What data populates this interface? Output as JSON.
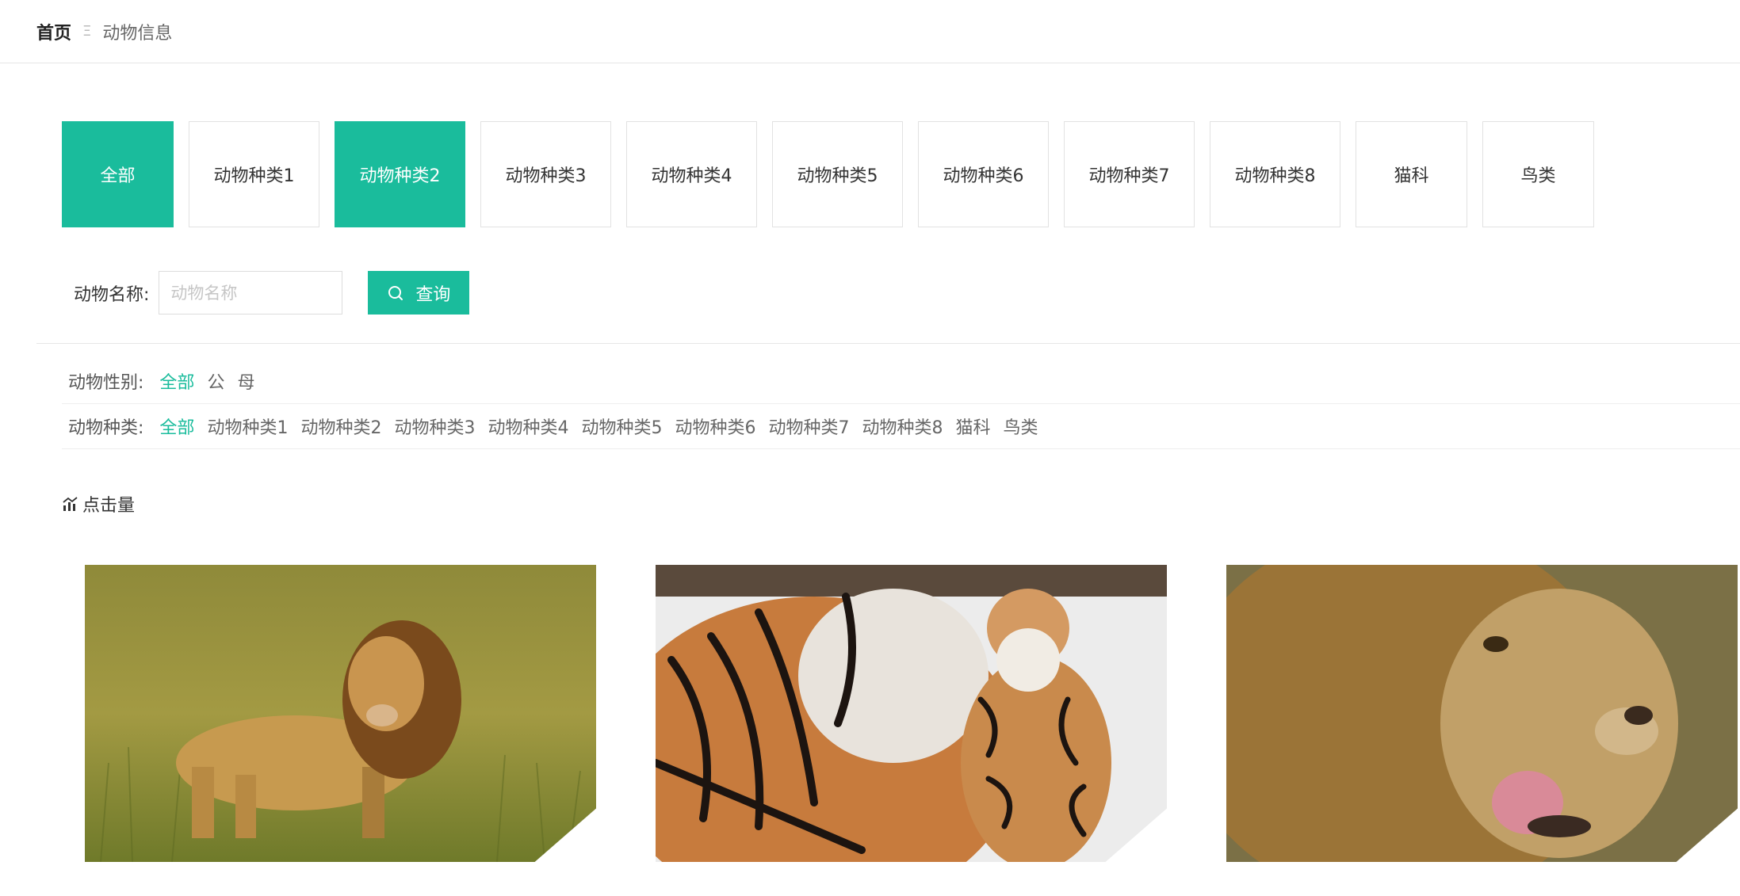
{
  "breadcrumb": {
    "home": "首页",
    "separator": "Ξ",
    "current": "动物信息"
  },
  "type_tabs": [
    {
      "label": "全部",
      "active": true
    },
    {
      "label": "动物种类1",
      "active": false
    },
    {
      "label": "动物种类2",
      "active": true
    },
    {
      "label": "动物种类3",
      "active": false
    },
    {
      "label": "动物种类4",
      "active": false
    },
    {
      "label": "动物种类5",
      "active": false
    },
    {
      "label": "动物种类6",
      "active": false
    },
    {
      "label": "动物种类7",
      "active": false
    },
    {
      "label": "动物种类8",
      "active": false
    },
    {
      "label": "猫科",
      "active": false
    },
    {
      "label": "鸟类",
      "active": false
    }
  ],
  "search": {
    "label": "动物名称:",
    "placeholder": "动物名称",
    "value": "",
    "button": "查询",
    "button_icon": "search-icon"
  },
  "filters": {
    "gender": {
      "label": "动物性别:",
      "options": [
        {
          "label": "全部",
          "active": true
        },
        {
          "label": "公",
          "active": false
        },
        {
          "label": "母",
          "active": false
        }
      ]
    },
    "kind": {
      "label": "动物种类:",
      "options": [
        {
          "label": "全部",
          "active": true
        },
        {
          "label": "动物种类1",
          "active": false
        },
        {
          "label": "动物种类2",
          "active": false
        },
        {
          "label": "动物种类3",
          "active": false
        },
        {
          "label": "动物种类4",
          "active": false
        },
        {
          "label": "动物种类5",
          "active": false
        },
        {
          "label": "动物种类6",
          "active": false
        },
        {
          "label": "动物种类7",
          "active": false
        },
        {
          "label": "动物种类8",
          "active": false
        },
        {
          "label": "猫科",
          "active": false
        },
        {
          "label": "鸟类",
          "active": false
        }
      ]
    }
  },
  "sort": {
    "label": "点击量",
    "icon": "bar-chart-icon"
  },
  "cards": [
    {
      "image": "lion-in-grass-photo"
    },
    {
      "image": "tiger-and-cub-in-snow-photo"
    },
    {
      "image": "lion-closeup-licking-photo"
    }
  ],
  "colors": {
    "accent": "#1abc9c",
    "border": "#e2e2e2",
    "text": "#333333"
  }
}
